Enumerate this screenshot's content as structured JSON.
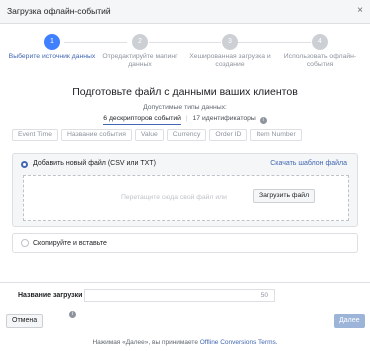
{
  "dialog": {
    "title": "Загрузка офлайн-событий",
    "close_glyph": "×"
  },
  "steps": [
    {
      "number": "1",
      "label": "Выберите источник данных",
      "active": true
    },
    {
      "number": "2",
      "label": "Отредактируйте мапинг данных",
      "active": false
    },
    {
      "number": "3",
      "label": "Хешированная загрузка и создание",
      "active": false
    },
    {
      "number": "4",
      "label": "Использовать офлайн-события",
      "active": false
    }
  ],
  "main": {
    "title": "Подготовьте файл с данными ваших клиентов",
    "allowed_types_label": "Допустимые типы данных:",
    "type_tabs": {
      "descriptors": "6 дескрипторов событий",
      "separator": "|",
      "identifiers": "17 идентификаторы"
    },
    "descriptor_chips": [
      "Event Time",
      "Название события",
      "Value",
      "Currency",
      "Order ID",
      "Item Number"
    ]
  },
  "upload": {
    "option_label": "Добавить новый файл (CSV или TXT)",
    "template_link": "Скачать шаблон файла",
    "drop_text": "Перетащите сюда свой файл или",
    "upload_button": "Загрузить файл"
  },
  "paste": {
    "option_label": "Скопируйте и вставьте"
  },
  "upload_name": {
    "label": "Название загрузки",
    "char_limit": "50"
  },
  "footer": {
    "cancel_label": "Отмена",
    "next_label": "Далее",
    "terms_prefix": "Нажимая «Далее», вы принимаете",
    "terms_link": "Offline Conversions Terms."
  },
  "colors": {
    "accent": "#4267b2",
    "step_active": "#4080ff",
    "step_inactive": "#ccd0d5",
    "next_disabled": "#9cb4d8"
  },
  "icons": {
    "close": "close-icon",
    "info": "info-icon"
  }
}
